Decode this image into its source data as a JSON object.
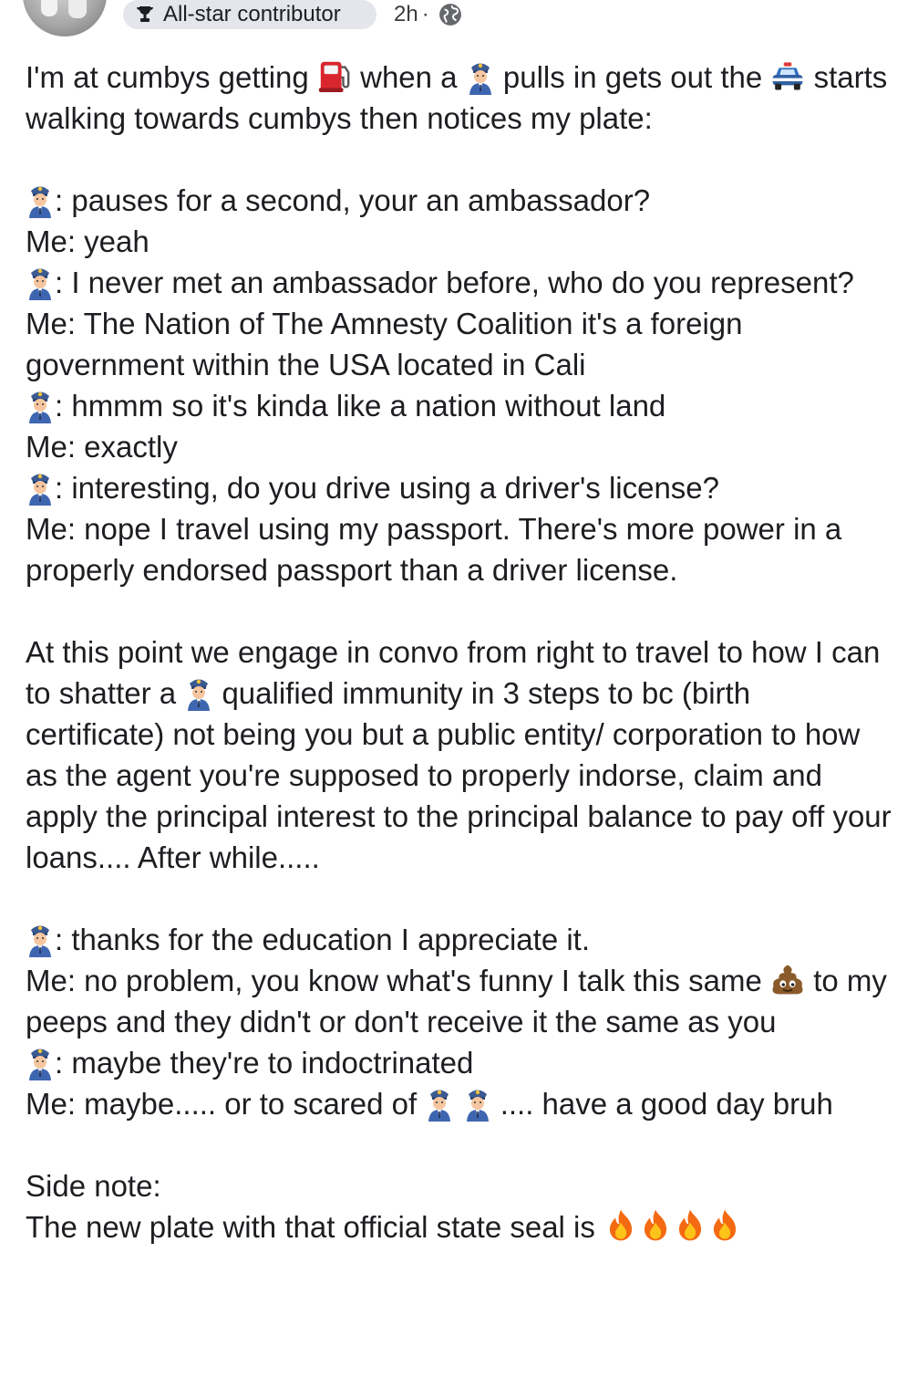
{
  "header": {
    "badge_label": "All-star contributor",
    "time": "2h",
    "separator": "·",
    "icons": {
      "badge": "trophy-icon",
      "audience": "globe-icon"
    }
  },
  "post": {
    "intro": {
      "t1": "I'm at cumbys getting",
      "t2": "when a",
      "t3": "pulls in gets out the",
      "t4": "starts walking towards cumbys then notices my plate:"
    },
    "d1": ": pauses for a second, your an ambassador?",
    "d2": "Me: yeah",
    "d3": ": I never met an ambassador before, who do you represent?",
    "d4": "Me: The Nation of The Amnesty Coalition it's a foreign government within the USA located in Cali",
    "d5": ": hmmm so it's kinda like a nation without land",
    "d6": "Me: exactly",
    "d7": ": interesting, do you drive using a driver's license?",
    "d8": "Me: nope I travel using my passport. There's more power in a properly endorsed passport than a driver license.",
    "para": {
      "t1": "At this point we engage in convo from right to travel to how I can to shatter a",
      "t2": "qualified immunity in 3 steps to bc (birth certificate) not being you but a public entity/ corporation to how as the agent you're supposed to properly indorse, claim and apply the principal interest to the principal balance to pay off your loans.... After while....."
    },
    "e1": ": thanks for the education I appreciate it.",
    "e2": "Me: no problem, you know what's funny I talk this same",
    "e3": "to my peeps and they didn't or don't receive it the same as you",
    "e4": ": maybe they're to indoctrinated",
    "e5a": "Me: maybe..... or to scared of",
    "e5b": ".... have a good day bruh",
    "side_note": "Side note:",
    "plate_line": "The new plate with that official state seal is",
    "emoji_names": [
      "fuel-pump-icon",
      "police-officer-icon",
      "police-car-icon",
      "pile-of-poo-icon",
      "fire-icon"
    ]
  }
}
